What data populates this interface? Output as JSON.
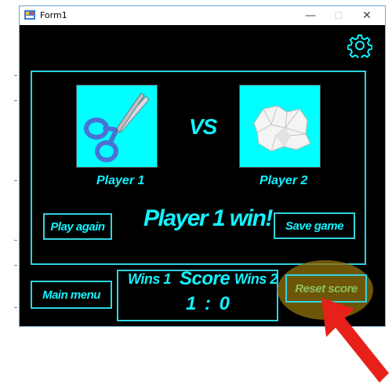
{
  "window": {
    "title": "Form1"
  },
  "titlebar": {
    "minimize": "—",
    "maximize": "☐",
    "close": "✕"
  },
  "settings": {
    "icon": "gear-icon"
  },
  "game": {
    "vs_label": "VS",
    "player1_label": "Player 1",
    "player2_label": "Player 2",
    "player1_choice_icon": "scissors-icon",
    "player2_choice_icon": "crumpled-paper-icon",
    "result": "Player 1 win!",
    "play_again": "Play again",
    "save_game": "Save game"
  },
  "score": {
    "wins1_label": "Wins 1",
    "title": "Score",
    "wins2_label": "Wins 2",
    "value": "1 : 0"
  },
  "nav": {
    "main_menu": "Main menu",
    "reset_score": "Reset score"
  },
  "colors": {
    "accent": "#12f2ff",
    "border": "#2fd4df",
    "background": "#000000",
    "highlight": "#8c6e0a",
    "arrow": "#e8201a"
  }
}
